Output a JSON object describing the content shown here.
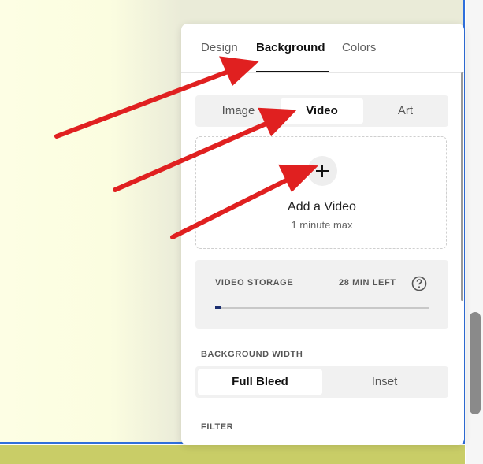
{
  "panel": {
    "tabs": [
      {
        "label": "Design",
        "active": false
      },
      {
        "label": "Background",
        "active": true
      },
      {
        "label": "Colors",
        "active": false
      }
    ],
    "media_type": {
      "options": [
        "Image",
        "Video",
        "Art"
      ],
      "selected": "Video"
    },
    "upload": {
      "title": "Add a Video",
      "subtitle": "1 minute max"
    },
    "storage": {
      "label": "VIDEO STORAGE",
      "remaining": "28 MIN LEFT",
      "used_fraction": 0.03
    },
    "background_width": {
      "label": "BACKGROUND WIDTH",
      "options": [
        "Full Bleed",
        "Inset"
      ],
      "selected": "Full Bleed"
    },
    "filter": {
      "label": "FILTER"
    }
  },
  "colors": {
    "accent_blue": "#2f6fdc",
    "annotation_arrow": "#e02020",
    "footer_strip": "#c9cd67",
    "canvas_bg": "#fdfee4"
  },
  "icons": [
    "plus-icon",
    "help-icon",
    "arrow-annotation"
  ]
}
